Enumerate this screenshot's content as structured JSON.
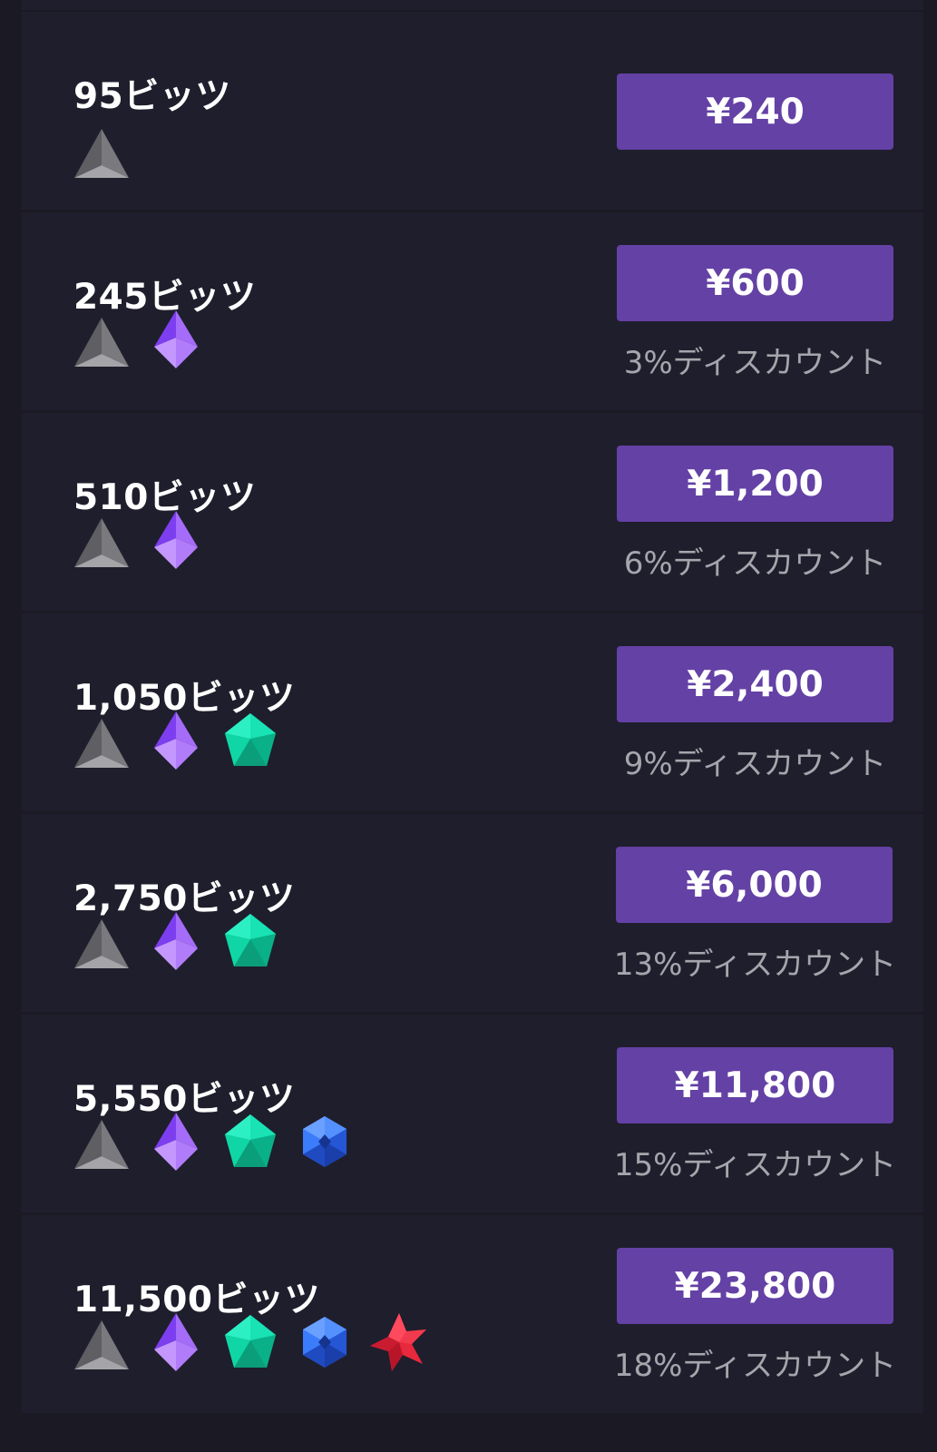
{
  "currency_symbol": "¥",
  "colors": {
    "background": "#1b1a24",
    "row_background": "#1f1e2c",
    "button": "#6441a5",
    "amount_text": "#ffffff",
    "discount_text": "#a6a5ad"
  },
  "packages": [
    {
      "amount": "95ビッツ",
      "price": "¥240",
      "discount": "",
      "gems": [
        "gray-triangle-gem-icon"
      ]
    },
    {
      "amount": "245ビッツ",
      "price": "¥600",
      "discount": "3%ディスカウント",
      "gems": [
        "gray-triangle-gem-icon",
        "purple-diamond-gem-icon"
      ]
    },
    {
      "amount": "510ビッツ",
      "price": "¥1,200",
      "discount": "6%ディスカウント",
      "gems": [
        "gray-triangle-gem-icon",
        "purple-diamond-gem-icon"
      ]
    },
    {
      "amount": "1,050ビッツ",
      "price": "¥2,400",
      "discount": "9%ディスカウント",
      "gems": [
        "gray-triangle-gem-icon",
        "purple-diamond-gem-icon",
        "green-pentagon-gem-icon"
      ]
    },
    {
      "amount": "2,750ビッツ",
      "price": "¥6,000",
      "discount": "13%ディスカウント",
      "gems": [
        "gray-triangle-gem-icon",
        "purple-diamond-gem-icon",
        "green-pentagon-gem-icon"
      ]
    },
    {
      "amount": "5,550ビッツ",
      "price": "¥11,800",
      "discount": "15%ディスカウント",
      "gems": [
        "gray-triangle-gem-icon",
        "purple-diamond-gem-icon",
        "green-pentagon-gem-icon",
        "blue-hexagon-gem-icon"
      ]
    },
    {
      "amount": "11,500ビッツ",
      "price": "¥23,800",
      "discount": "18%ディスカウント",
      "gems": [
        "gray-triangle-gem-icon",
        "purple-diamond-gem-icon",
        "green-pentagon-gem-icon",
        "blue-hexagon-gem-icon",
        "red-star-gem-icon"
      ]
    }
  ]
}
